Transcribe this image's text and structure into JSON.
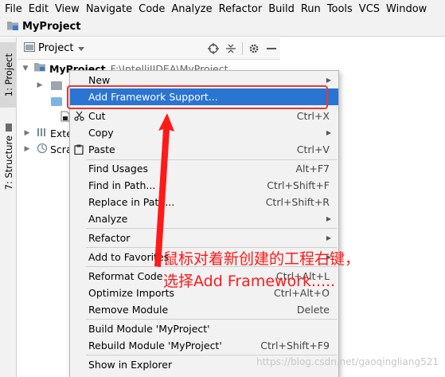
{
  "menubar": [
    "File",
    "Edit",
    "View",
    "Navigate",
    "Code",
    "Analyze",
    "Refactor",
    "Build",
    "Run",
    "Tools",
    "VCS",
    "Window"
  ],
  "breadcrumb": {
    "project": "MyProject"
  },
  "sidebar": {
    "project_tab": "1: Project",
    "structure_tab": "7: Structure"
  },
  "project_panel": {
    "view_label": "Project"
  },
  "tree": {
    "root": {
      "name": "MyProject",
      "path": "F:\\IntelliJIDEA\\MyProject"
    },
    "external": "Exte",
    "scratches": "Scra"
  },
  "context_menu": {
    "items": [
      {
        "label": "New",
        "shortcut": ""
      },
      {
        "label": "Add Framework Support...",
        "shortcut": ""
      },
      {
        "label": "Cut",
        "shortcut": "Ctrl+X"
      },
      {
        "label": "Copy",
        "shortcut": ""
      },
      {
        "label": "Paste",
        "shortcut": "Ctrl+V"
      },
      {
        "label": "Find Usages",
        "shortcut": "Alt+F7"
      },
      {
        "label": "Find in Path...",
        "shortcut": "Ctrl+Shift+F"
      },
      {
        "label": "Replace in Path...",
        "shortcut": "Ctrl+Shift+R"
      },
      {
        "label": "Analyze",
        "shortcut": ""
      },
      {
        "label": "Refactor",
        "shortcut": ""
      },
      {
        "label": "Add to Favorites",
        "shortcut": ""
      },
      {
        "label": "Reformat Code",
        "shortcut": "Ctrl+Alt+L"
      },
      {
        "label": "Optimize Imports",
        "shortcut": "Ctrl+Alt+O"
      },
      {
        "label": "Remove Module",
        "shortcut": "Delete"
      },
      {
        "label": "Build Module 'MyProject'",
        "shortcut": ""
      },
      {
        "label": "Rebuild Module 'MyProject'",
        "shortcut": "Ctrl+Shift+F9"
      },
      {
        "label": "Show in Explorer",
        "shortcut": ""
      }
    ]
  },
  "annotation": {
    "line1": "鼠标对着新创建的工程右键，",
    "line2": "选择Add Framework....."
  },
  "watermark": "https://blog.csdn.net/gaoqingliang521",
  "colors": {
    "highlight": "#2a74d2",
    "annotation": "#ff1a1a",
    "menu_bg": "#f2f2f2"
  }
}
